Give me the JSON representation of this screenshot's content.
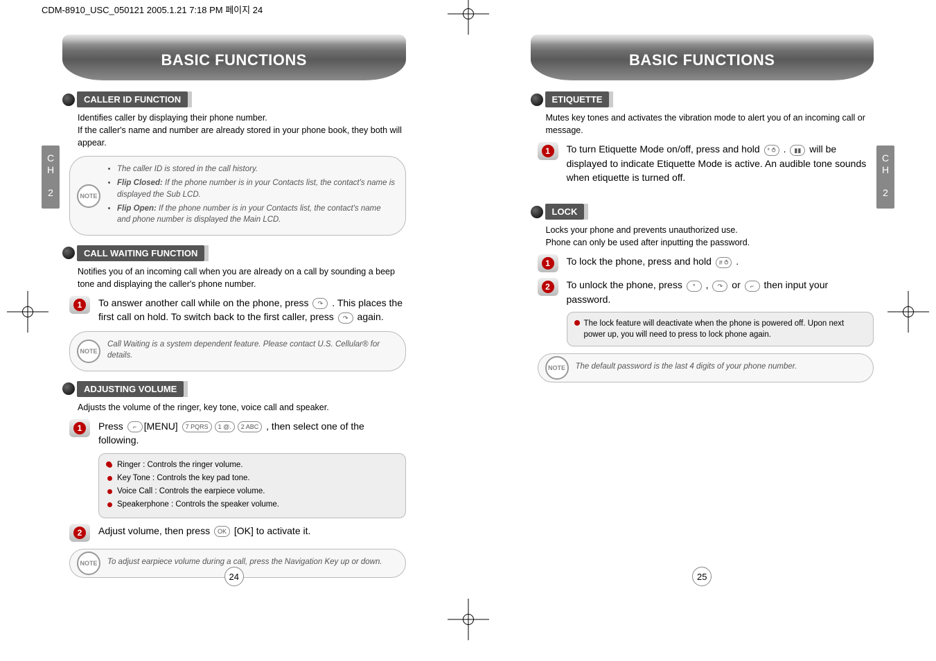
{
  "header_strip": "CDM-8910_USC_050121  2005.1.21 7:18 PM  페이지 24",
  "chapter": {
    "label": "C\nH\n2"
  },
  "left": {
    "title": "BASIC FUNCTIONS",
    "sections": {
      "caller_id": {
        "heading": "CALLER ID FUNCTION",
        "body": "Identifies caller by displaying their phone number.\nIf the caller's name and number are already stored in your phone book, they both will appear.",
        "note": {
          "items": [
            {
              "text": "The caller ID is stored in the call history."
            },
            {
              "bold": "Flip Closed:",
              "text": " If the phone number is in your Contacts list, the contact's name is displayed the Sub LCD."
            },
            {
              "bold": "Flip Open:",
              "text": " If the phone number is in your Contacts list, the contact's name and phone number is displayed the Main LCD."
            }
          ]
        }
      },
      "call_waiting": {
        "heading": "CALL WAITING FUNCTION",
        "body": "Notifies you of an incoming call when you are already on a call by sounding a beep tone and displaying the caller's phone number.",
        "step1_a": "To answer another call while on the phone, press ",
        "step1_b": " . This places the first call on hold. To switch back to the first caller, press ",
        "step1_c": " again.",
        "note": "Call Waiting is a system dependent feature. Please contact U.S. Cellular® for details."
      },
      "adjusting_volume": {
        "heading": "ADJUSTING VOLUME",
        "body": "Adjusts the volume of the ringer, key tone, voice call and speaker.",
        "step1_a": "Press ",
        "step1_b": "[MENU] ",
        "step1_c": " , then select one of the following.",
        "options": [
          "Ringer : Controls the ringer volume.",
          "Key Tone : Controls the key pad tone.",
          "Voice Call : Controls the earpiece volume.",
          "Speakerphone : Controls the speaker volume."
        ],
        "step2_a": "Adjust volume, then press ",
        "step2_b": " [OK] to activate it.",
        "note": "To adjust earpiece volume during a call, press the Navigation Key up or down."
      }
    },
    "page_number": "24"
  },
  "right": {
    "title": "BASIC FUNCTIONS",
    "sections": {
      "etiquette": {
        "heading": "ETIQUETTE",
        "body": "Mutes key tones and activates the vibration mode to alert you of an incoming call or message.",
        "step1_a": "To turn Etiquette Mode on/off, press and hold ",
        "step1_b": " . ",
        "step1_c": " will be displayed to indicate Etiquette Mode is active. An audible tone sounds when etiquette is turned off."
      },
      "lock": {
        "heading": "LOCK",
        "body": "Locks your phone and prevents unauthorized use.\nPhone can only be used after inputting the password.",
        "step1_a": "To lock the phone, press and hold ",
        "step1_b": " .",
        "step2_a": "To unlock the phone, press ",
        "step2_b": " , ",
        "step2_c": " or ",
        "step2_d": " then input your password.",
        "info": "The lock feature will deactivate when the phone is powered off. Upon next power up, you will need to press        to lock phone again.",
        "note": "The default password is the last 4 digits of your phone number."
      }
    },
    "page_number": "25"
  },
  "keys": {
    "send": "↷",
    "soft_left": "⌐",
    "num7": "7 PQRS",
    "num1": "1 @.",
    "num2": "2 ABC",
    "ok": "OK",
    "star_lock": "* ⥀",
    "hash_lock": "# ⥀",
    "star": "*",
    "vibrate": "▮▮"
  }
}
